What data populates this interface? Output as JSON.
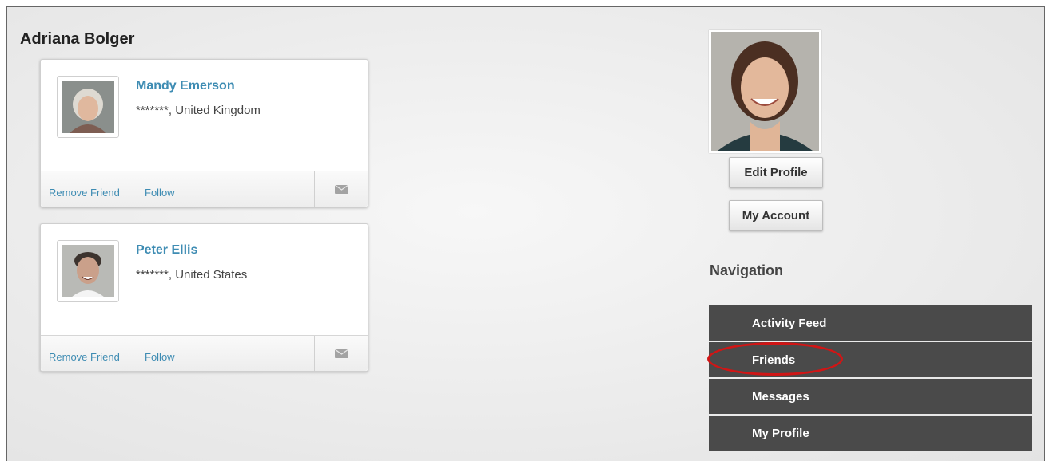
{
  "profile": {
    "name": "Adriana Bolger",
    "edit_profile_label": "Edit Profile",
    "my_account_label": "My Account"
  },
  "friends": [
    {
      "name": "Mandy Emerson",
      "location": "*******, United Kingdom",
      "remove_label": "Remove Friend",
      "follow_label": "Follow"
    },
    {
      "name": "Peter Ellis",
      "location": "*******, United States",
      "remove_label": "Remove Friend",
      "follow_label": "Follow"
    }
  ],
  "navigation": {
    "heading": "Navigation",
    "items": [
      {
        "label": "Activity Feed"
      },
      {
        "label": "Friends",
        "highlighted": true
      },
      {
        "label": "Messages"
      },
      {
        "label": "My Profile"
      }
    ]
  },
  "colors": {
    "link": "#3e8cb3",
    "nav_bg": "#4a4a4a",
    "highlight": "#d11515"
  },
  "icons": {
    "message": "envelope-icon"
  }
}
